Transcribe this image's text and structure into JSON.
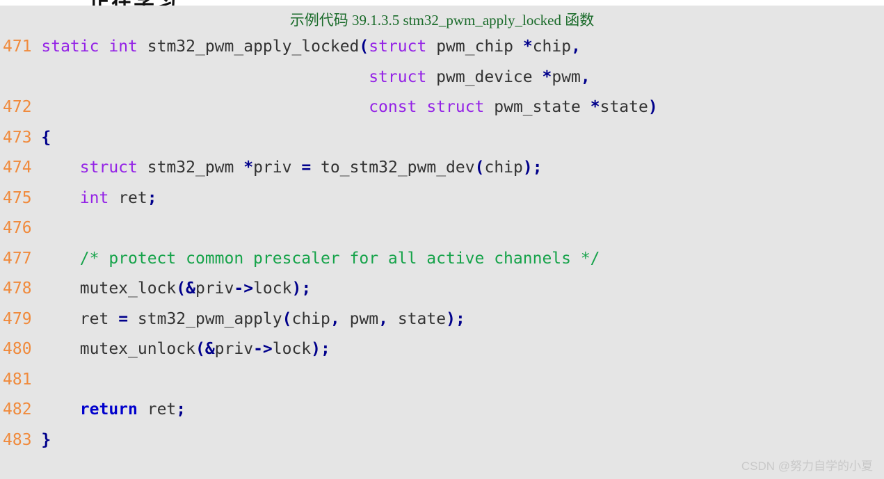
{
  "page": {
    "background_color": "#ffffff",
    "code_background_color": "#e5e5e5",
    "cut_off_heading": "正在学习"
  },
  "code_block": {
    "title": "示例代码 39.1.3.5 stm32_pwm_apply_locked 函数",
    "title_color": "#1a6b2a",
    "language": "c",
    "colors": {
      "line_number": "#f08a3c",
      "keyword": "#9422e6",
      "keyword_bold": "#0000cc",
      "identifier": "#333333",
      "operator": "#00008b",
      "comment": "#16a34a"
    },
    "lines": [
      {
        "number": "471",
        "text": "static int stm32_pwm_apply_locked(struct pwm_chip *chip,"
      },
      {
        "number": "",
        "text": "                                  struct pwm_device *pwm,"
      },
      {
        "number": "472",
        "text": "                                  const struct pwm_state *state)"
      },
      {
        "number": "473",
        "text": "{"
      },
      {
        "number": "474",
        "text": "    struct stm32_pwm *priv = to_stm32_pwm_dev(chip);"
      },
      {
        "number": "475",
        "text": "    int ret;"
      },
      {
        "number": "476",
        "text": ""
      },
      {
        "number": "477",
        "text": "    /* protect common prescaler for all active channels */"
      },
      {
        "number": "478",
        "text": "    mutex_lock(&priv->lock);"
      },
      {
        "number": "479",
        "text": "    ret = stm32_pwm_apply(chip, pwm, state);"
      },
      {
        "number": "480",
        "text": "    mutex_unlock(&priv->lock);"
      },
      {
        "number": "481",
        "text": ""
      },
      {
        "number": "482",
        "text": "    return ret;"
      },
      {
        "number": "483",
        "text": "}"
      }
    ]
  },
  "watermark": {
    "text": "CSDN @努力自学的小夏"
  }
}
